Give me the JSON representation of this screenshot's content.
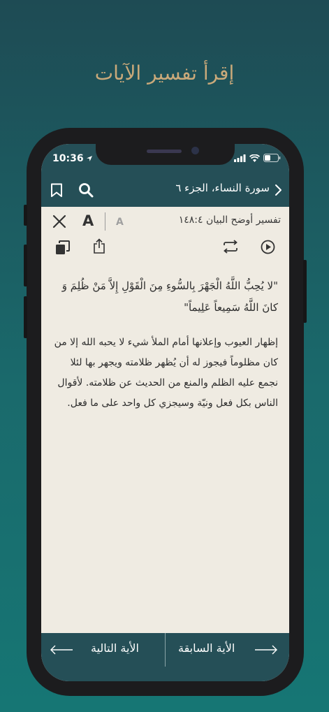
{
  "headline": "إقرأ تفسير الآيات",
  "status_bar": {
    "time": "10:36"
  },
  "nav": {
    "title": "سورة النساء، الجزء ٦",
    "icons": [
      "chevron-right-icon",
      "search-icon",
      "bookmark-icon"
    ]
  },
  "toolbar": {
    "tafsir_title": "تفسير أوضح البيان ١٤٨:٤",
    "font_large_label": "A",
    "font_small_label": "A",
    "icons": [
      "close-icon",
      "copy-icon",
      "share-icon",
      "repeat-icon",
      "play-icon"
    ]
  },
  "content": {
    "verse": "\"لا يُحِبُّ اللَّهُ الْجَهْرَ بِالسُّوءِ مِنَ الْقَوْلِ إِلاَّ مَنْ ظُلِمَ وَ كانَ اللَّهُ سَمِيعاً عَلِيماً\"",
    "explanation": "إظهار العيوب وإعلانها أمام الملأ شيء لا يحبه الله إلا من كان مظلوماً فيجوز له أن يُظهر ظلامته ويجهر بها لئلا نجمع عليه الظلم والمنع من الحديث عن ظلامته. لأقوال الناس بكل فعل ونيّة وسيجزي كل واحد على ما فعل."
  },
  "bottom_bar": {
    "next_label": "الأية التالية",
    "prev_label": "الأية السابقة"
  },
  "colors": {
    "background_top": "#1e4b54",
    "background_bottom": "#167674",
    "bar": "#254f57",
    "content_bg": "#efebe2",
    "headline": "#c9a97a"
  }
}
